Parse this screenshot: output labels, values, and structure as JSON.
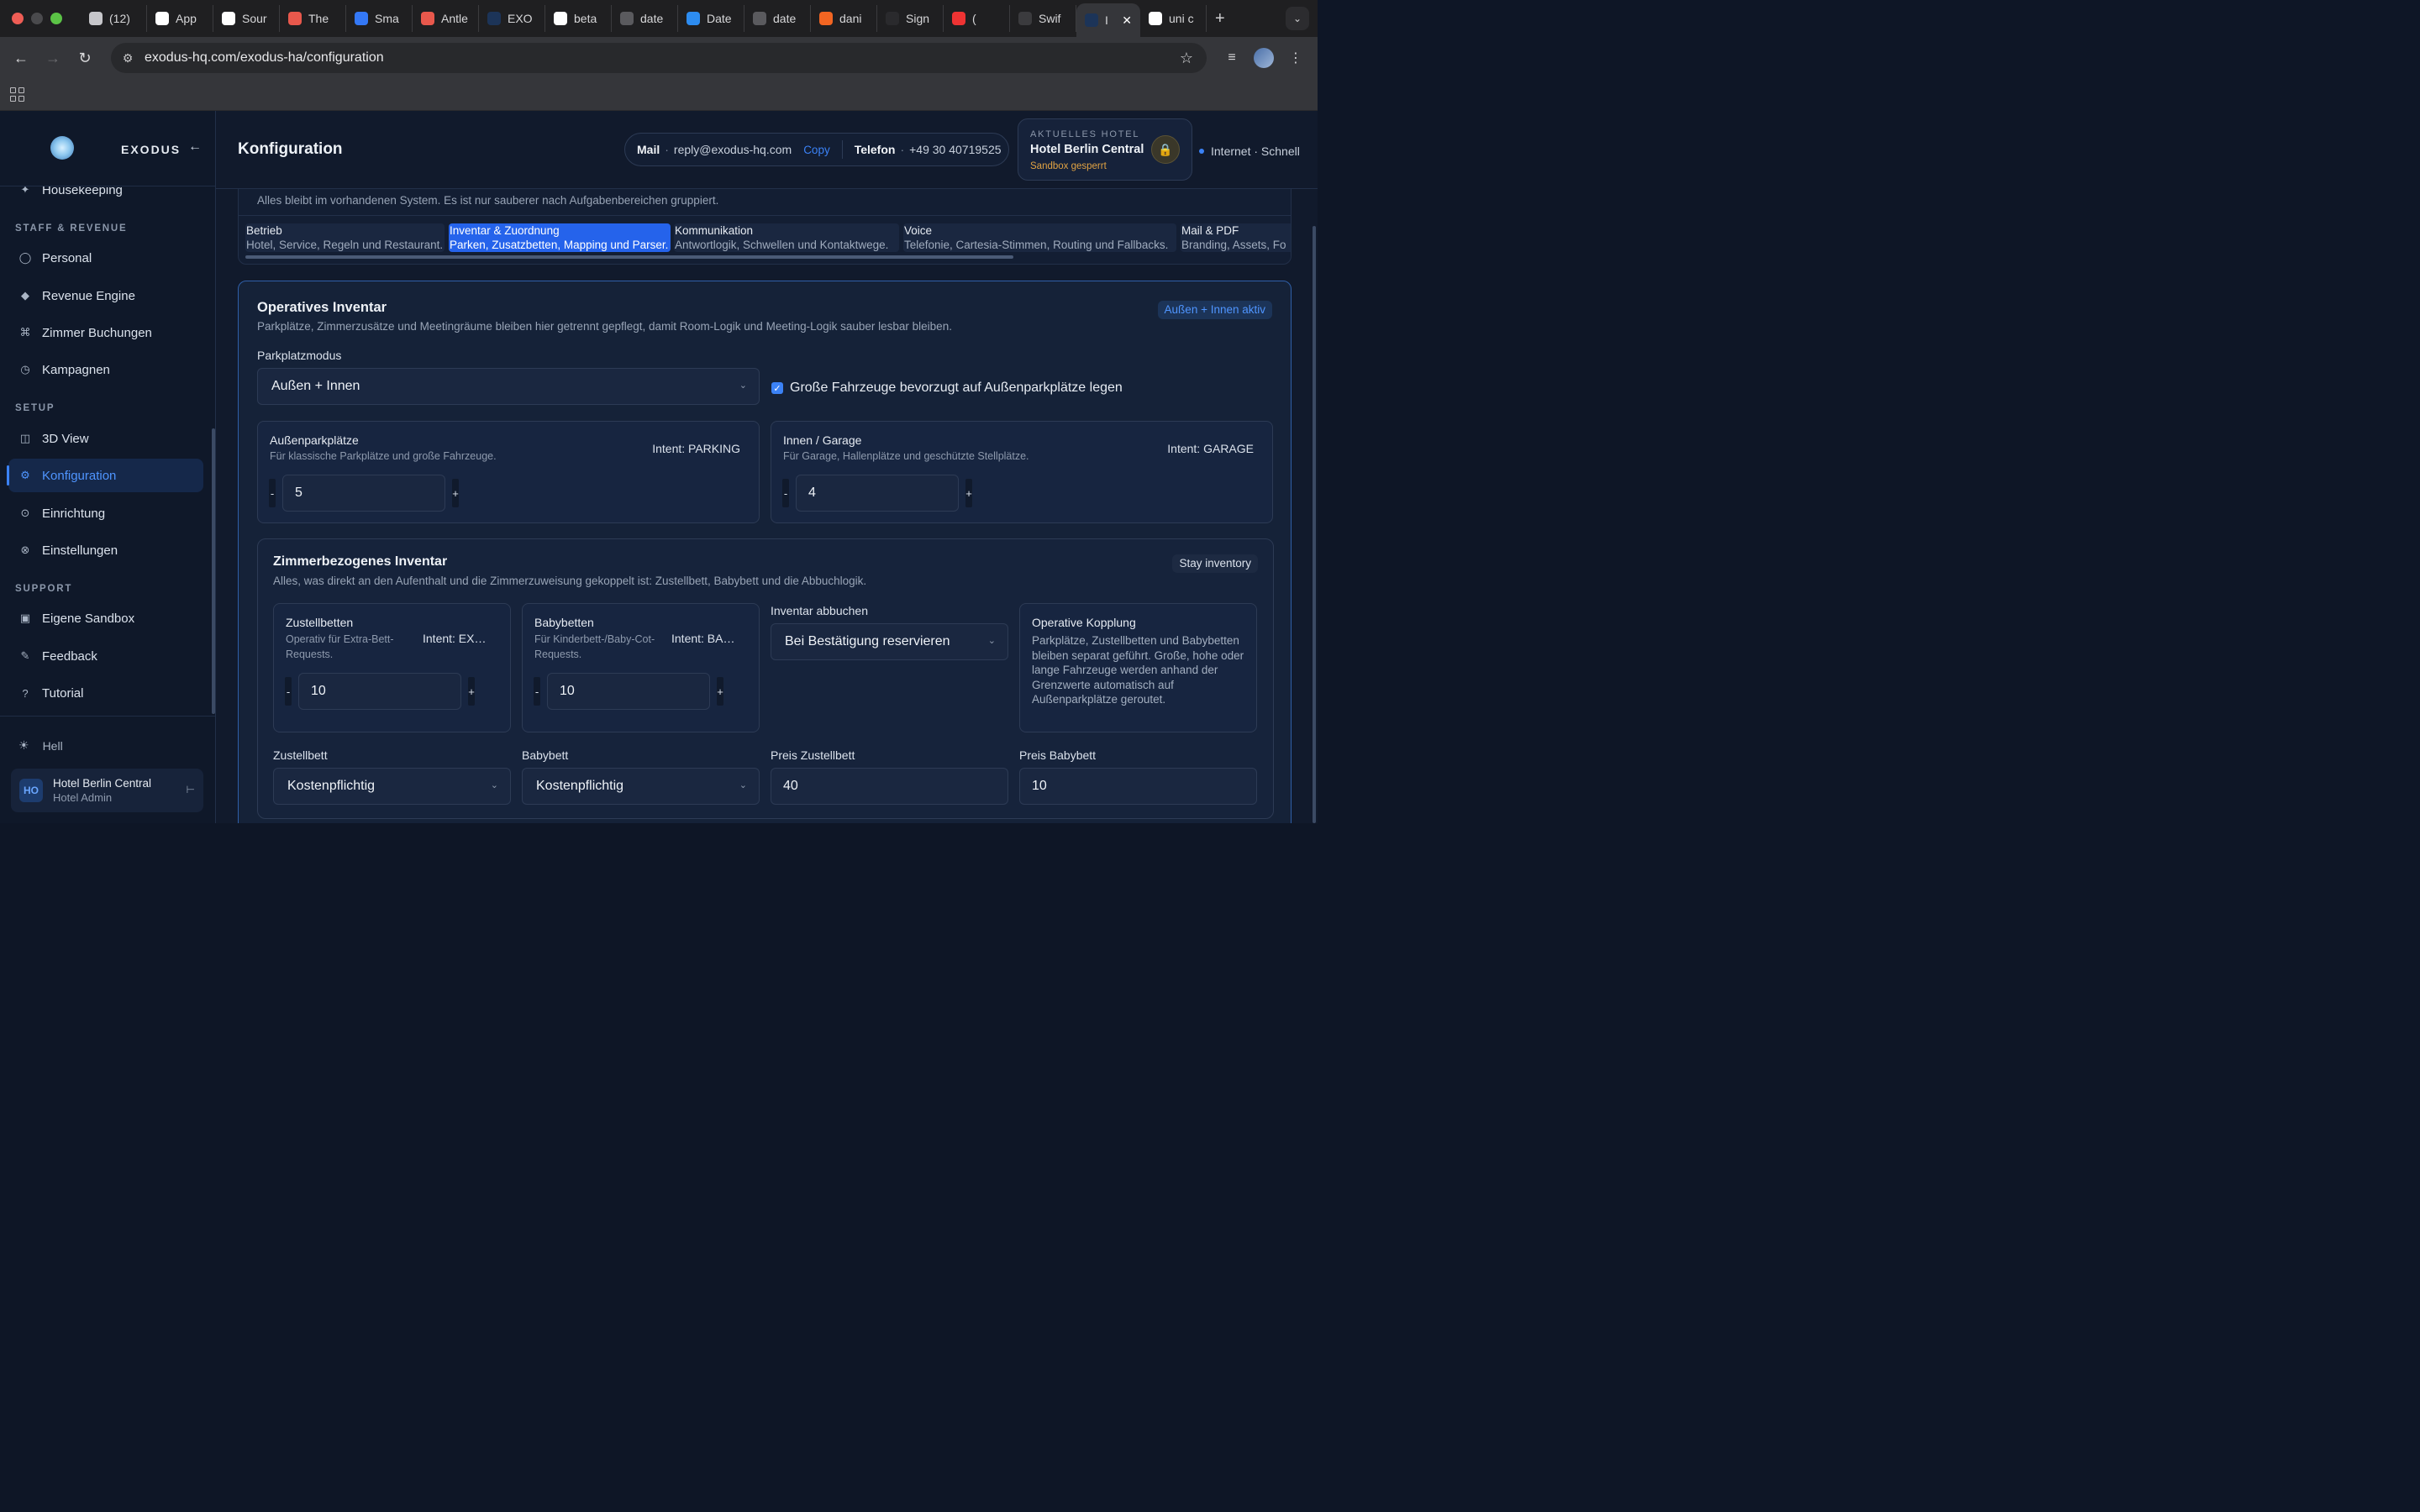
{
  "browser": {
    "tabs": [
      {
        "label": "(12)",
        "icon": "gmail-icon",
        "color": "#c7c7cb"
      },
      {
        "label": "App",
        "icon": "openai-icon",
        "color": "#ffffff"
      },
      {
        "label": "Sour",
        "icon": "w-icon",
        "color": "#ffffff"
      },
      {
        "label": "The",
        "icon": "p-icon",
        "color": "#e8584c"
      },
      {
        "label": "Sma",
        "icon": "on-icon",
        "color": "#3478f6"
      },
      {
        "label": "Antle",
        "icon": "antle-icon",
        "color": "#e8584c"
      },
      {
        "label": "EXO",
        "icon": "exodus-icon",
        "color": "#1c3458"
      },
      {
        "label": "beta",
        "icon": "google-icon",
        "color": "#ffffff"
      },
      {
        "label": "date",
        "icon": "globe-icon",
        "color": "#5a5a5e"
      },
      {
        "label": "Date",
        "icon": "appstore-icon",
        "color": "#2d8cf0"
      },
      {
        "label": "date",
        "icon": "globe-icon",
        "color": "#5a5a5e"
      },
      {
        "label": "dani",
        "icon": "ycombinator-icon",
        "color": "#f26522"
      },
      {
        "label": "Sign",
        "icon": "sign-icon",
        "color": "#2a2a2d"
      },
      {
        "label": "(",
        "icon": "youtube-icon",
        "color": "#e33"
      },
      {
        "label": "Swif",
        "icon": "gemini-icon",
        "color": "#3b3b3e"
      }
    ],
    "active_tab_label": "I",
    "last_tab_label": "uni c",
    "url": "exodus-hq.com/exodus-ha/configuration"
  },
  "sidebar": {
    "brand": "EXODUS",
    "partial_item": "Housekeeping",
    "sections": {
      "staff": "STAFF & REVENUE",
      "setup": "SETUP",
      "support": "SUPPORT"
    },
    "items": {
      "personal": "Personal",
      "revenue": "Revenue Engine",
      "zimmer": "Zimmer Buchungen",
      "kampagnen": "Kampagnen",
      "view3d": "3D View",
      "konfiguration": "Konfiguration",
      "einrichtung": "Einrichtung",
      "einstellungen": "Einstellungen",
      "sandbox": "Eigene Sandbox",
      "feedback": "Feedback",
      "tutorial": "Tutorial"
    },
    "theme_label": "Hell",
    "user": {
      "initials": "HO",
      "name": "Hotel Berlin Central",
      "role": "Hotel Admin"
    }
  },
  "header": {
    "title": "Konfiguration",
    "mail_label": "Mail",
    "mail_value": "reply@exodus-hq.com",
    "copy_label": "Copy",
    "phone_label": "Telefon",
    "phone_value": "+49 30 40719525",
    "hotel_label": "AKTUELLES HOTEL",
    "hotel_name": "Hotel Berlin Central",
    "hotel_status": "Sandbox gesperrt",
    "net_status": "Internet · Schnell"
  },
  "categories": {
    "description": "Alles bleibt im vorhandenen System. Es ist nur sauberer nach Aufgabenbereichen gruppiert.",
    "tabs": [
      {
        "title": "Betrieb",
        "subtitle": "Hotel, Service, Regeln und Restaurant."
      },
      {
        "title": "Inventar & Zuordnung",
        "subtitle": "Parken, Zusatzbetten, Mapping und Parser."
      },
      {
        "title": "Kommunikation",
        "subtitle": "Antwortlogik, Schwellen und Kontaktwege."
      },
      {
        "title": "Voice",
        "subtitle": "Telefonie, Cartesia-Stimmen, Routing und Fallbacks."
      },
      {
        "title": "Mail & PDF",
        "subtitle": "Branding, Assets, Fo"
      }
    ]
  },
  "inventory": {
    "title": "Operatives Inventar",
    "description": "Parkplätze, Zimmerzusätze und Meetingräume bleiben hier getrennt gepflegt, damit Room-Logik und Meeting-Logik sauber lesbar bleiben.",
    "badge": "Außen + Innen aktiv",
    "parking_mode_label": "Parkplatzmodus",
    "parking_mode_value": "Außen + Innen",
    "large_vehicles_label": "Große Fahrzeuge bevorzugt auf Außenparkplätze legen",
    "large_vehicles_checked": true,
    "outdoor": {
      "title": "Außenparkplätze",
      "description": "Für klassische Parkplätze und große Fahrzeuge.",
      "intent": "Intent: PARKING",
      "value": "5"
    },
    "indoor": {
      "title": "Innen / Garage",
      "description": "Für Garage, Hallenplätze und geschützte Stellplätze.",
      "intent": "Intent: GARAGE",
      "value": "4"
    },
    "stepper_minus": "-",
    "stepper_plus": "+"
  },
  "room_inventory": {
    "title": "Zimmerbezogenes Inventar",
    "description": "Alles, was direkt an den Aufenthalt und die Zimmerzuweisung gekoppelt ist: Zustellbett, Babybett und die Abbuchlogik.",
    "badge": "Stay inventory",
    "extra_bed": {
      "title": "Zustellbetten",
      "description": "Operativ für Extra-Bett-Requests.",
      "intent": "Intent: EXTRA_BED",
      "value": "10"
    },
    "baby_bed": {
      "title": "Babybetten",
      "description": "Für Kinderbett-/Baby-Cot-Requests.",
      "intent": "Intent: BABY_BED",
      "value": "10"
    },
    "booking_label": "Inventar abbuchen",
    "booking_value": "Bei Bestätigung reservieren",
    "coupling_title": "Operative Kopplung",
    "coupling_text": "Parkplätze, Zustellbetten und Babybetten bleiben separat geführt. Große, hohe oder lange Fahrzeuge werden anhand der Grenzwerte automatisch auf Außenparkplätze geroutet.",
    "extra_bed_label": "Zustellbett",
    "extra_bed_value": "Kostenpflichtig",
    "baby_bed_label": "Babybett",
    "baby_bed_value": "Kostenpflichtig",
    "price_extra_label": "Preis Zustellbett",
    "price_extra_value": "40",
    "price_baby_label": "Preis Babybett",
    "price_baby_value": "10"
  },
  "colors": {
    "accent": "#3b82f6",
    "background": "#111a2c",
    "warning": "#e0a243"
  }
}
